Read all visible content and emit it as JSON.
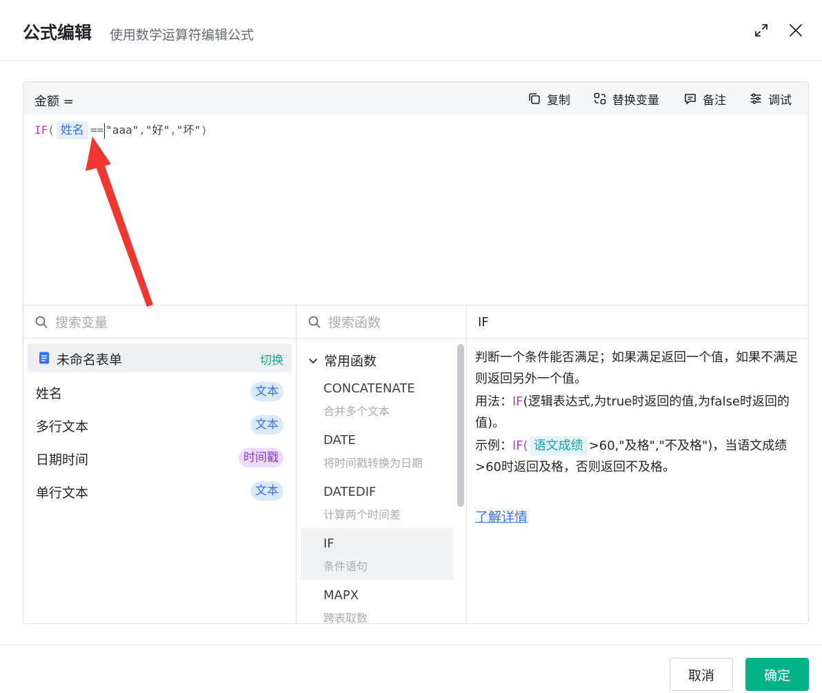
{
  "dialog": {
    "title": "公式编辑",
    "subtitle": "使用数学运算符编辑公式"
  },
  "formula": {
    "label": "金额 =",
    "code": {
      "fn": "IF",
      "open": "(",
      "variable": "姓名",
      "operator": "==",
      "arg1": "\"aaa\"",
      "comma1": ",",
      "arg2": "\"好\"",
      "comma2": ",",
      "arg3": "\"坏\"",
      "close": ")"
    }
  },
  "toolbar": {
    "copy": "复制",
    "replace_var": "替换变量",
    "note": "备注",
    "debug": "调试"
  },
  "variables": {
    "search_placeholder": "搜索变量",
    "form_name": "未命名表单",
    "switch_label": "切换",
    "items": [
      {
        "name": "姓名",
        "type": "文本"
      },
      {
        "name": "多行文本",
        "type": "文本"
      },
      {
        "name": "日期时间",
        "type": "时间戳"
      },
      {
        "name": "单行文本",
        "type": "文本"
      }
    ]
  },
  "functions": {
    "search_placeholder": "搜索函数",
    "group": "常用函数",
    "items": [
      {
        "name": "CONCATENATE",
        "desc": "合并多个文本"
      },
      {
        "name": "DATE",
        "desc": "将时间戳转换为日期"
      },
      {
        "name": "DATEDIF",
        "desc": "计算两个时间差"
      },
      {
        "name": "IF",
        "desc": "条件语句"
      },
      {
        "name": "MAPX",
        "desc": "跨表取数"
      }
    ]
  },
  "description": {
    "title": "IF",
    "summary": "判断一个条件能否满足；如果满足返回一个值，如果不满足则返回另外一个值。",
    "usage_label": "用法：",
    "usage_fn": "IF",
    "usage_rest": "(逻辑表达式,为true时返回的值,为false时返回的值)。",
    "example_label": "示例：",
    "example_fn": "IF(",
    "example_var": "语文成绩",
    "example_rest": ">60,\"及格\",\"不及格\")，当语文成绩>60时返回及格，否则返回不及格。",
    "more_link": "了解详情"
  },
  "footer": {
    "cancel": "取消",
    "ok": "确定"
  },
  "colors": {
    "primary": "#00b386",
    "link": "#3370ff",
    "keyword": "#c03ec0",
    "arrow": "#f0362f"
  }
}
